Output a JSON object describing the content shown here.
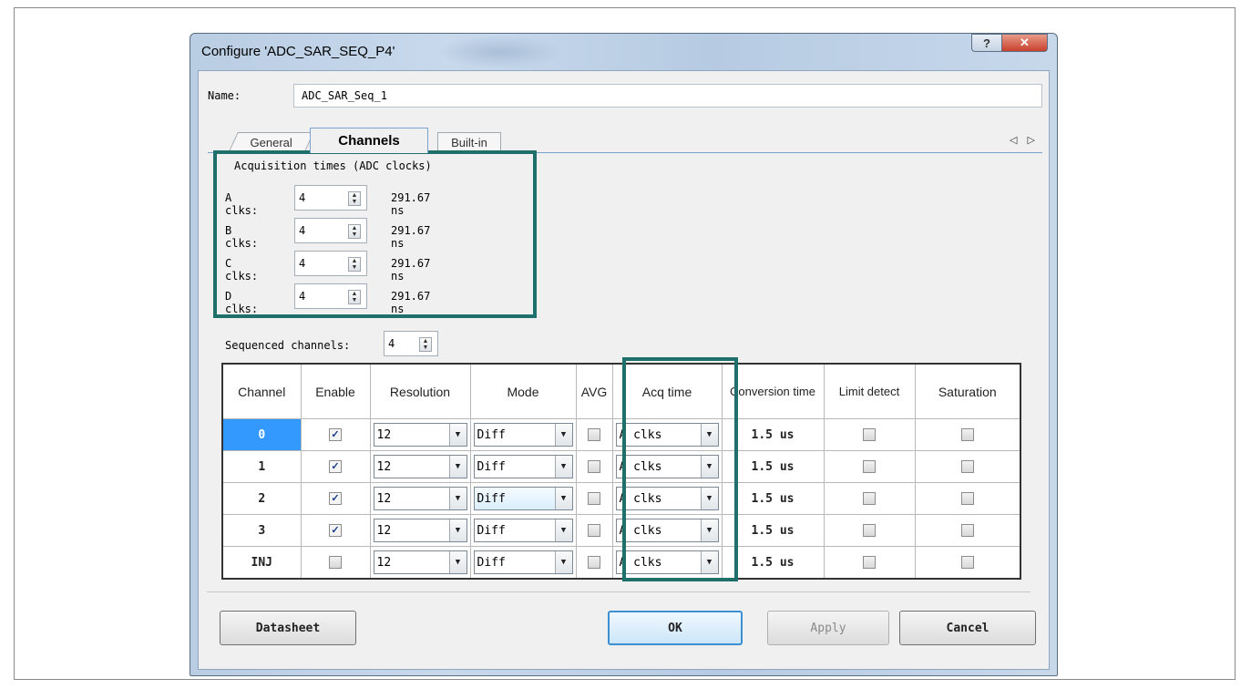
{
  "window": {
    "title": "Configure 'ADC_SAR_SEQ_P4'",
    "help_glyph": "?",
    "close_glyph": "✕"
  },
  "name": {
    "label": "Name:",
    "value": "ADC_SAR_Seq_1"
  },
  "tabs": [
    {
      "label": "General",
      "active": false
    },
    {
      "label": "Channels",
      "active": true
    },
    {
      "label": "Built-in",
      "active": false
    }
  ],
  "tab_scroll_glyphs": "◁ ▷",
  "acquisition": {
    "title": "Acquisition times (ADC clocks)",
    "rows": [
      {
        "label": "A clks:",
        "value": "4",
        "time": "291.67 ns"
      },
      {
        "label": "B clks:",
        "value": "4",
        "time": "291.67 ns"
      },
      {
        "label": "C clks:",
        "value": "4",
        "time": "291.67 ns"
      },
      {
        "label": "D clks:",
        "value": "4",
        "time": "291.67 ns"
      }
    ]
  },
  "sequenced": {
    "label": "Sequenced channels:",
    "value": "4"
  },
  "table": {
    "headers": [
      "Channel",
      "Enable",
      "Resolution",
      "Mode",
      "AVG",
      "Acq time",
      "Conversion time",
      "Limit detect",
      "Saturation"
    ],
    "rows": [
      {
        "channel": "0",
        "enable": true,
        "resolution": "12",
        "mode": "Diff",
        "avg": false,
        "acq": "A clks",
        "conv": "1.5 us",
        "limit": false,
        "sat": false
      },
      {
        "channel": "1",
        "enable": true,
        "resolution": "12",
        "mode": "Diff",
        "avg": false,
        "acq": "A clks",
        "conv": "1.5 us",
        "limit": false,
        "sat": false
      },
      {
        "channel": "2",
        "enable": true,
        "resolution": "12",
        "mode": "Diff",
        "avg": false,
        "acq": "A clks",
        "conv": "1.5 us",
        "limit": false,
        "sat": false
      },
      {
        "channel": "3",
        "enable": true,
        "resolution": "12",
        "mode": "Diff",
        "avg": false,
        "acq": "A clks",
        "conv": "1.5 us",
        "limit": false,
        "sat": false
      },
      {
        "channel": "INJ",
        "enable": false,
        "resolution": "12",
        "mode": "Diff",
        "avg": false,
        "acq": "A clks",
        "conv": "1.5 us",
        "limit": false,
        "sat": false
      }
    ]
  },
  "buttons": {
    "datasheet": "Datasheet",
    "ok": "OK",
    "apply": "Apply",
    "cancel": "Cancel"
  },
  "colors": {
    "highlight_box": "#1f6f6a",
    "selected_row": "#3399ff"
  }
}
